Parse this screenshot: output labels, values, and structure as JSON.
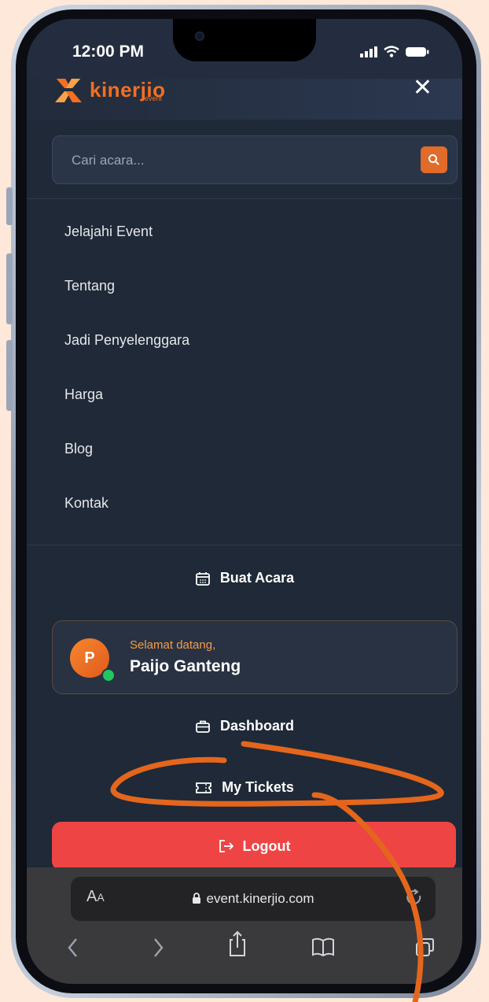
{
  "status_bar": {
    "time": "12:00 PM"
  },
  "header": {
    "logo_text": "kinerjio",
    "logo_sub": "event"
  },
  "search": {
    "placeholder": "Cari acara..."
  },
  "nav": {
    "items": [
      {
        "label": "Jelajahi Event"
      },
      {
        "label": "Tentang"
      },
      {
        "label": "Jadi Penyelenggara"
      },
      {
        "label": "Harga"
      },
      {
        "label": "Blog"
      },
      {
        "label": "Kontak"
      }
    ]
  },
  "actions": {
    "create_event_label": "Buat Acara"
  },
  "user": {
    "greeting": "Selamat datang,",
    "name": "Paijo Ganteng",
    "avatar_initial": "P"
  },
  "links": {
    "dashboard_label": "Dashboard",
    "tickets_label": "My Tickets",
    "logout_label": "Logout"
  },
  "browser": {
    "url": "event.kinerjio.com",
    "text_size_label_big": "A",
    "text_size_label_small": "A"
  },
  "colors": {
    "accent": "#e06b2a",
    "logout": "#ef4444",
    "annotation": "#e4661c",
    "online": "#22c55e"
  }
}
